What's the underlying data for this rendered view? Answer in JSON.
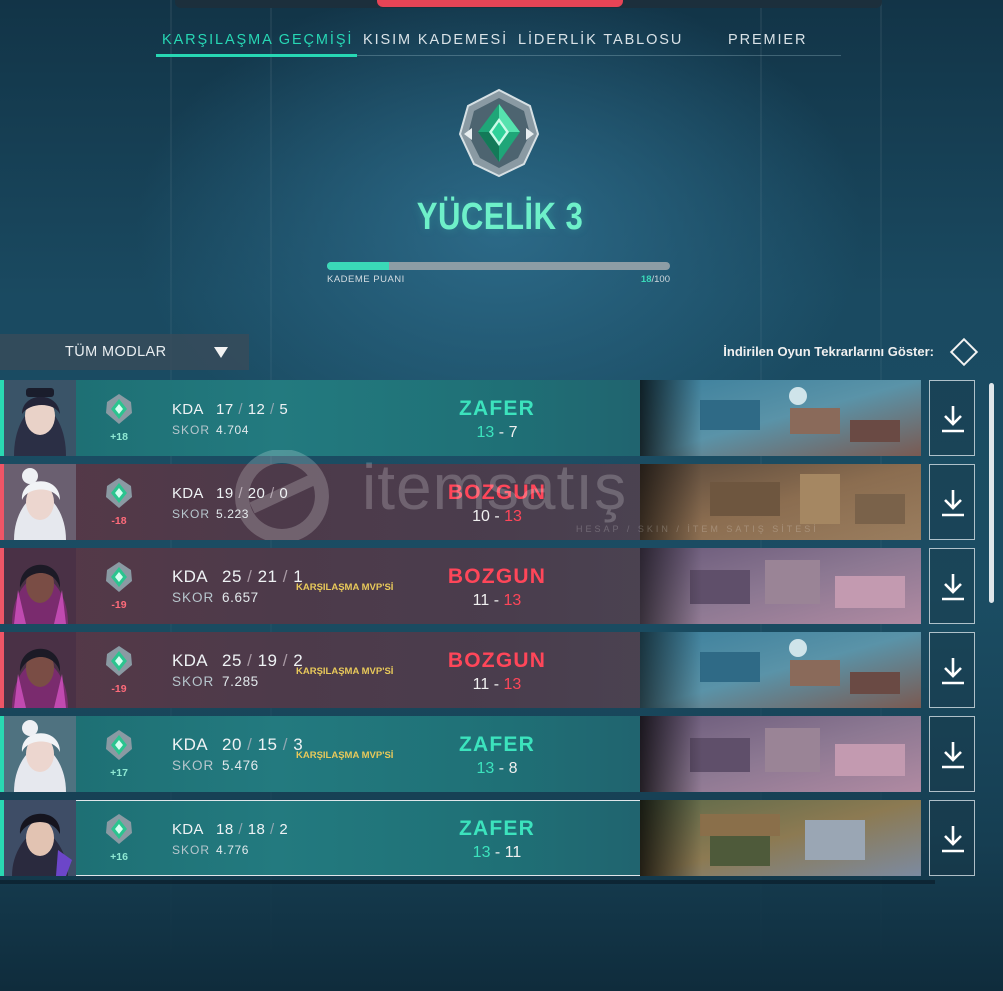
{
  "tabs": [
    {
      "label": "KARŞILAŞMA GEÇMİŞİ",
      "active": true
    },
    {
      "label": "KISIM KADEMESİ",
      "active": false
    },
    {
      "label": "LİDERLİK TABLOSU",
      "active": false
    },
    {
      "label": "PREMIER",
      "active": false
    }
  ],
  "rank": {
    "title": "YÜCELİK 3",
    "icon": "ascendant-rank-icon",
    "rr_label": "KADEME PUANI",
    "rr_current": "18",
    "rr_max": "/100",
    "rr_fraction": 0.18
  },
  "filter": {
    "mode_label": "TÜM MODLAR",
    "replay_label": "İndirilen Oyun Tekrarlarını Göster:"
  },
  "matches": [
    {
      "result": "ZAFER",
      "rr_change": "+18",
      "kda_label": "KDA",
      "kills": "17",
      "deaths": "12",
      "assists": "5",
      "score_label": "SKOR",
      "score": "4.704",
      "mvp": "",
      "team_score": "13",
      "enemy_score": "7",
      "score_sep": "-",
      "map": "icebox-map"
    },
    {
      "result": "BOZGUN",
      "rr_change": "-18",
      "kda_label": "KDA",
      "kills": "19",
      "deaths": "20",
      "assists": "0",
      "score_label": "SKOR",
      "score": "5.223",
      "mvp": "",
      "team_score": "10",
      "enemy_score": "13",
      "score_sep": "-",
      "map": "bind-map"
    },
    {
      "result": "BOZGUN",
      "rr_change": "-19",
      "kda_label": "KDA",
      "kills": "25",
      "deaths": "21",
      "assists": "1",
      "score_label": "SKOR",
      "score": "6.657",
      "mvp": "KARŞILAŞMA MVP'Sİ",
      "team_score": "11",
      "enemy_score": "13",
      "score_sep": "-",
      "map": "split-map"
    },
    {
      "result": "BOZGUN",
      "rr_change": "-19",
      "kda_label": "KDA",
      "kills": "25",
      "deaths": "19",
      "assists": "2",
      "score_label": "SKOR",
      "score": "7.285",
      "mvp": "KARŞILAŞMA MVP'Sİ",
      "team_score": "11",
      "enemy_score": "13",
      "score_sep": "-",
      "map": "icebox-map"
    },
    {
      "result": "ZAFER",
      "rr_change": "+17",
      "kda_label": "KDA",
      "kills": "20",
      "deaths": "15",
      "assists": "3",
      "score_label": "SKOR",
      "score": "5.476",
      "mvp": "KARŞILAŞMA MVP'Sİ",
      "team_score": "13",
      "enemy_score": "8",
      "score_sep": "-",
      "map": "split-map"
    },
    {
      "result": "ZAFER",
      "rr_change": "+16",
      "kda_label": "KDA",
      "kills": "18",
      "deaths": "18",
      "assists": "2",
      "score_label": "SKOR",
      "score": "4.776",
      "mvp": "",
      "team_score": "13",
      "enemy_score": "11",
      "score_sep": "-",
      "map": "haven-map"
    }
  ],
  "watermark": {
    "text": "itemsatış",
    "sub": "HESAP / SKIN / İTEM SATIŞ SİTESİ"
  },
  "colors": {
    "win": "#3ce3bd",
    "loss": "#ff4659",
    "mvp": "#e8c95a",
    "accent": "#27d7b4"
  }
}
